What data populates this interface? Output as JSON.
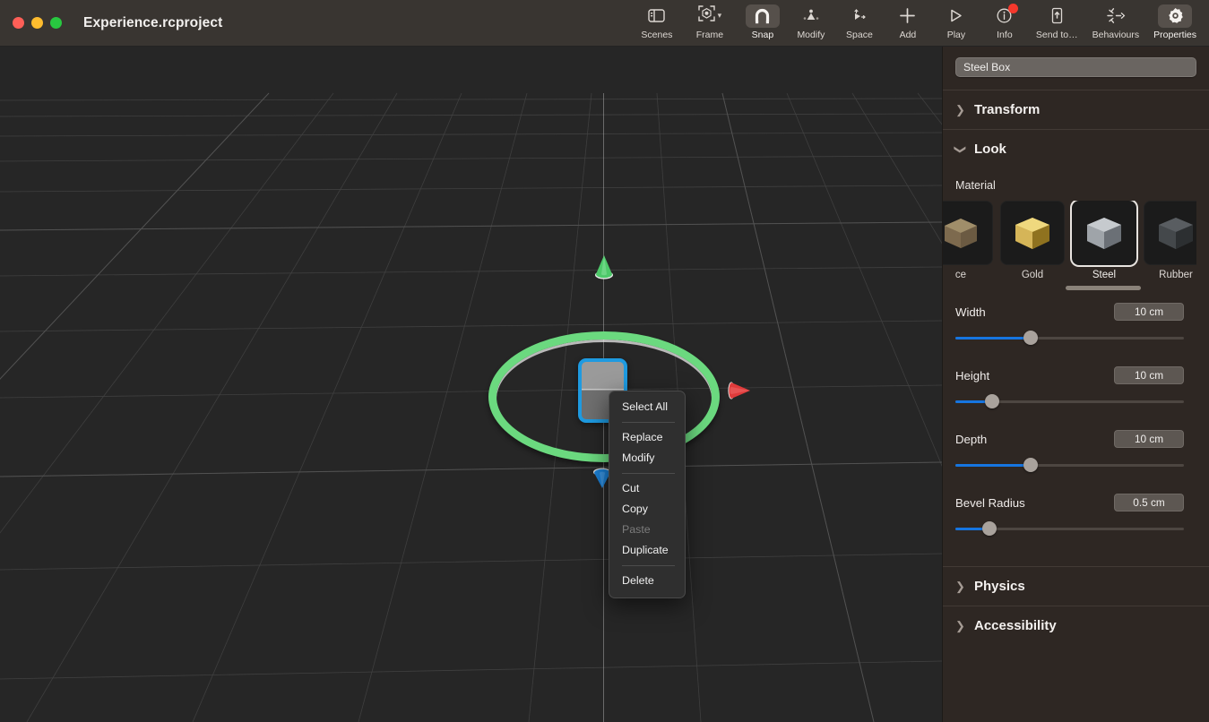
{
  "window": {
    "title": "Experience.rcproject",
    "traffic_lights": [
      "close",
      "minimize",
      "maximize"
    ]
  },
  "toolbar": {
    "items": [
      {
        "label": "Scenes",
        "icon": "sidebar-panel-icon",
        "active": false,
        "has_chevron": false,
        "badge": false
      },
      {
        "label": "Frame",
        "icon": "frame-object-icon",
        "active": false,
        "has_chevron": true,
        "badge": false
      },
      {
        "label": "Snap",
        "icon": "magnet-icon",
        "active": true,
        "has_chevron": false,
        "badge": false
      },
      {
        "label": "Modify",
        "icon": "modify-icon",
        "active": false,
        "has_chevron": false,
        "badge": false
      },
      {
        "label": "Space",
        "icon": "space-icon",
        "active": false,
        "has_chevron": false,
        "badge": false
      },
      {
        "label": "Add",
        "icon": "plus-icon",
        "active": false,
        "has_chevron": false,
        "badge": false
      },
      {
        "label": "Play",
        "icon": "play-icon",
        "active": false,
        "has_chevron": false,
        "badge": false
      },
      {
        "label": "Info",
        "icon": "info-circle-icon",
        "active": false,
        "has_chevron": false,
        "badge": true
      },
      {
        "label": "Send to…",
        "icon": "send-to-icon",
        "active": false,
        "has_chevron": false,
        "badge": false
      },
      {
        "label": "Behaviours",
        "icon": "behaviours-icon",
        "active": false,
        "has_chevron": false,
        "badge": false
      },
      {
        "label": "Properties",
        "icon": "gear-icon",
        "active": true,
        "has_chevron": false,
        "badge": false
      }
    ]
  },
  "viewport": {
    "objects": {
      "selected_box": "steel-box",
      "gizmo": "rotation-ring",
      "axis_handles": [
        "y-axis-cone-green",
        "x-axis-cone-red",
        "z-axis-cone-blue"
      ]
    },
    "colors": {
      "background": "#262626",
      "grid_line": "#3c3c3c",
      "gizmo_ring": "#6bd97f",
      "selection_outline": "#1e9ae0",
      "x_axis": "#e03b3b",
      "y_axis": "#4ec96a",
      "z_axis": "#1b7fd4"
    }
  },
  "context_menu": {
    "groups": [
      [
        {
          "label": "Select All",
          "disabled": false
        }
      ],
      [
        {
          "label": "Replace",
          "disabled": false
        },
        {
          "label": "Modify",
          "disabled": false
        }
      ],
      [
        {
          "label": "Cut",
          "disabled": false
        },
        {
          "label": "Copy",
          "disabled": false
        },
        {
          "label": "Paste",
          "disabled": true
        },
        {
          "label": "Duplicate",
          "disabled": false
        }
      ],
      [
        {
          "label": "Delete",
          "disabled": false
        }
      ]
    ]
  },
  "panel": {
    "object_name": "Steel Box",
    "sections": [
      {
        "title": "Transform",
        "expanded": false,
        "chevron": "chevron-right-icon"
      },
      {
        "title": "Look",
        "expanded": true,
        "chevron": "chevron-down-icon"
      },
      {
        "title": "Physics",
        "expanded": false,
        "chevron": "chevron-right-icon"
      },
      {
        "title": "Accessibility",
        "expanded": false,
        "chevron": "chevron-right-icon"
      }
    ],
    "look": {
      "material_label": "Material",
      "materials": [
        {
          "name": "ce",
          "swatch": "#6e5c42",
          "selected": false,
          "partial": true
        },
        {
          "name": "Gold",
          "swatch": "#d8b24a",
          "selected": false,
          "partial": false
        },
        {
          "name": "Steel",
          "swatch": "#9aa0a6",
          "selected": true,
          "partial": false
        },
        {
          "name": "Rubber",
          "swatch": "#44474a",
          "selected": false,
          "partial": false
        },
        {
          "name": "",
          "swatch": "#b4792c",
          "selected": false,
          "partial": true
        }
      ],
      "properties": [
        {
          "label": "Width",
          "value": "10 cm",
          "percent": 33
        },
        {
          "label": "Height",
          "value": "10 cm",
          "percent": 16
        },
        {
          "label": "Depth",
          "value": "10 cm",
          "percent": 33
        },
        {
          "label": "Bevel Radius",
          "value": "0.5 cm",
          "percent": 15
        }
      ]
    }
  },
  "colors": {
    "titlebar_bg": "#393531",
    "panel_bg": "#2e2723",
    "accent_blue": "#1675e0",
    "badge_red": "#f5382c"
  }
}
